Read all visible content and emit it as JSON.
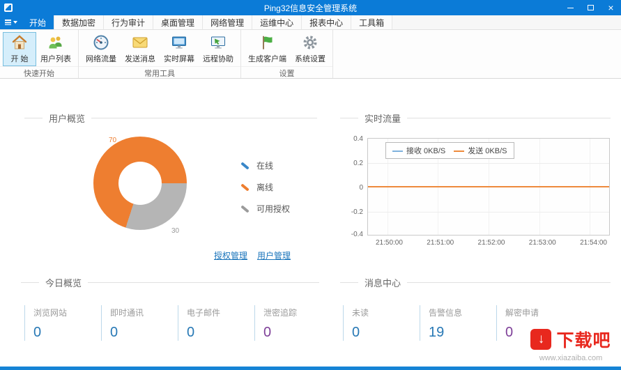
{
  "colors": {
    "accent": "#0b7bd7",
    "donut_offline": "#ee7e30",
    "donut_available": "#b5b5b5",
    "legend_online": "#3a87c8",
    "stat_blue": "#2778b5",
    "stat_purple": "#7e3f98",
    "traffic_receive": "#7fb2dd",
    "traffic_send": "#ee8a3c",
    "watermark_red": "#e8281e"
  },
  "window": {
    "title": "Ping32信息安全管理系统",
    "close_glyph": "×"
  },
  "tabs": [
    {
      "label": "开始",
      "active": true
    },
    {
      "label": "数据加密"
    },
    {
      "label": "行为审计"
    },
    {
      "label": "桌面管理"
    },
    {
      "label": "网络管理"
    },
    {
      "label": "运维中心"
    },
    {
      "label": "报表中心"
    },
    {
      "label": "工具箱"
    }
  ],
  "ribbon": {
    "groups": [
      {
        "label": "快速开始",
        "buttons": [
          {
            "label": "开 始",
            "icon": "home-icon",
            "selected": true
          },
          {
            "label": "用户列表",
            "icon": "users-icon"
          }
        ]
      },
      {
        "label": "常用工具",
        "buttons": [
          {
            "label": "网络流量",
            "icon": "gauge-icon"
          },
          {
            "label": "发送消息",
            "icon": "message-icon"
          },
          {
            "label": "实时屏幕",
            "icon": "screen-icon"
          },
          {
            "label": "远程协助",
            "icon": "remote-icon"
          }
        ]
      },
      {
        "label": "设置",
        "buttons": [
          {
            "label": "生成客户端",
            "icon": "flag-icon"
          },
          {
            "label": "系统设置",
            "icon": "gear-icon"
          }
        ]
      }
    ]
  },
  "user_overview": {
    "title": "用户概览",
    "donut_labels": {
      "offline": "70",
      "available": "30"
    },
    "legend": [
      {
        "label": "在线",
        "color": "#3a87c8"
      },
      {
        "label": "离线",
        "color": "#ee7e30"
      },
      {
        "label": "可用授权",
        "color": "#9b9b9b"
      }
    ],
    "links": [
      {
        "label": "授权管理"
      },
      {
        "label": "用户管理"
      }
    ]
  },
  "traffic": {
    "title": "实时流量",
    "legend": [
      {
        "label": "接收 0KB/S",
        "color": "#7fb2dd"
      },
      {
        "label": "发送 0KB/S",
        "color": "#ee8a3c"
      }
    ],
    "y_ticks": [
      "0.4",
      "0.2",
      "0",
      "-0.2",
      "-0.4"
    ],
    "x_ticks": [
      "21:50:00",
      "21:51:00",
      "21:52:00",
      "21:53:00",
      "21:54:00"
    ]
  },
  "today": {
    "title": "今日概览",
    "stats": [
      {
        "label": "浏览网站",
        "value": "0"
      },
      {
        "label": "即时通讯",
        "value": "0"
      },
      {
        "label": "电子邮件",
        "value": "0"
      },
      {
        "label": "泄密追踪",
        "value": "0"
      }
    ]
  },
  "messages": {
    "title": "消息中心",
    "stats": [
      {
        "label": "未读",
        "value": "0"
      },
      {
        "label": "告警信息",
        "value": "19"
      },
      {
        "label": "解密申请",
        "value": "0"
      }
    ]
  },
  "watermark": {
    "name": "下载吧",
    "url": "www.xiazaiba.com",
    "icon_glyph": "↓"
  },
  "chart_data": [
    {
      "type": "pie",
      "title": "用户概览",
      "donut": true,
      "labels": [
        "在线",
        "离线",
        "可用授权"
      ],
      "values": [
        0,
        70,
        30
      ],
      "colors": [
        "#3a87c8",
        "#ee7e30",
        "#b5b5b5"
      ],
      "data_labels": [
        "70",
        "30"
      ],
      "legend_position": "right"
    },
    {
      "type": "line",
      "title": "实时流量",
      "x": [
        "21:50:00",
        "21:51:00",
        "21:52:00",
        "21:53:00",
        "21:54:00"
      ],
      "series": [
        {
          "name": "接收 0KB/S",
          "values": [
            0,
            0,
            0,
            0,
            0
          ],
          "color": "#7fb2dd"
        },
        {
          "name": "发送 0KB/S",
          "values": [
            0,
            0,
            0,
            0,
            0
          ],
          "color": "#ee8a3c"
        }
      ],
      "ylim": [
        -0.4,
        0.4
      ],
      "grid": true,
      "legend_position": "top"
    }
  ]
}
